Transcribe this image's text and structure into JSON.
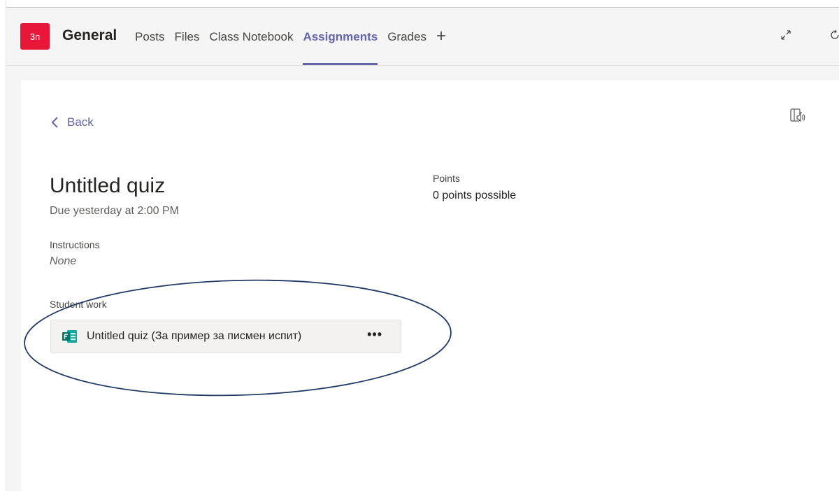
{
  "header": {
    "team_initials": "3п",
    "channel_name": "General",
    "tabs": [
      {
        "label": "Posts"
      },
      {
        "label": "Files"
      },
      {
        "label": "Class Notebook"
      },
      {
        "label": "Assignments"
      },
      {
        "label": "Grades"
      }
    ],
    "add_tab_glyph": "+",
    "icons": [
      "expand-icon",
      "refresh-icon"
    ]
  },
  "assignment": {
    "back_label": "Back",
    "title": "Untitled quiz",
    "due": "Due yesterday at 2:00 PM",
    "instructions_label": "Instructions",
    "instructions_value": "None",
    "points_label": "Points",
    "points_value": "0 points possible",
    "student_work_label": "Student work",
    "student_work_file": "Untitled quiz (За пример за писмен испит)",
    "file_menu_glyph": "•••"
  },
  "colors": {
    "accent": "#6264a7",
    "team_avatar": "#e8173a",
    "forms_icon": "#077568",
    "annotation_ellipse": "#1f3864"
  }
}
